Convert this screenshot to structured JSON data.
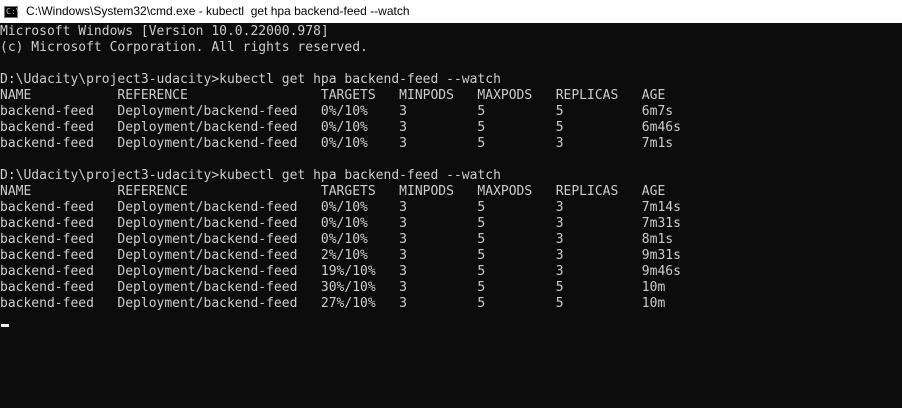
{
  "window": {
    "title": "C:\\Windows\\System32\\cmd.exe - kubectl  get hpa backend-feed --watch",
    "icon": "cmd-icon",
    "icon_glyph": "C:\\"
  },
  "colors": {
    "background": "#0c0c0c",
    "text": "#cccccc",
    "titlebar": "#ffffff"
  },
  "console": {
    "lines": [
      "Microsoft Windows [Version 10.0.22000.978]",
      "(c) Microsoft Corporation. All rights reserved.",
      "",
      "D:\\Udacity\\project3-udacity>kubectl get hpa backend-feed --watch",
      "NAME           REFERENCE                 TARGETS   MINPODS   MAXPODS   REPLICAS   AGE",
      "backend-feed   Deployment/backend-feed   0%/10%    3         5         5          6m7s",
      "backend-feed   Deployment/backend-feed   0%/10%    3         5         5          6m46s",
      "backend-feed   Deployment/backend-feed   0%/10%    3         5         3          7m1s",
      "",
      "D:\\Udacity\\project3-udacity>kubectl get hpa backend-feed --watch",
      "NAME           REFERENCE                 TARGETS   MINPODS   MAXPODS   REPLICAS   AGE",
      "backend-feed   Deployment/backend-feed   0%/10%    3         5         3          7m14s",
      "backend-feed   Deployment/backend-feed   0%/10%    3         5         3          7m31s",
      "backend-feed   Deployment/backend-feed   0%/10%    3         5         3          8m1s",
      "backend-feed   Deployment/backend-feed   2%/10%    3         5         3          9m31s",
      "backend-feed   Deployment/backend-feed   19%/10%   3         5         3          9m46s",
      "backend-feed   Deployment/backend-feed   30%/10%   3         5         5          10m",
      "backend-feed   Deployment/backend-feed   27%/10%   3         5         5          10m"
    ]
  }
}
